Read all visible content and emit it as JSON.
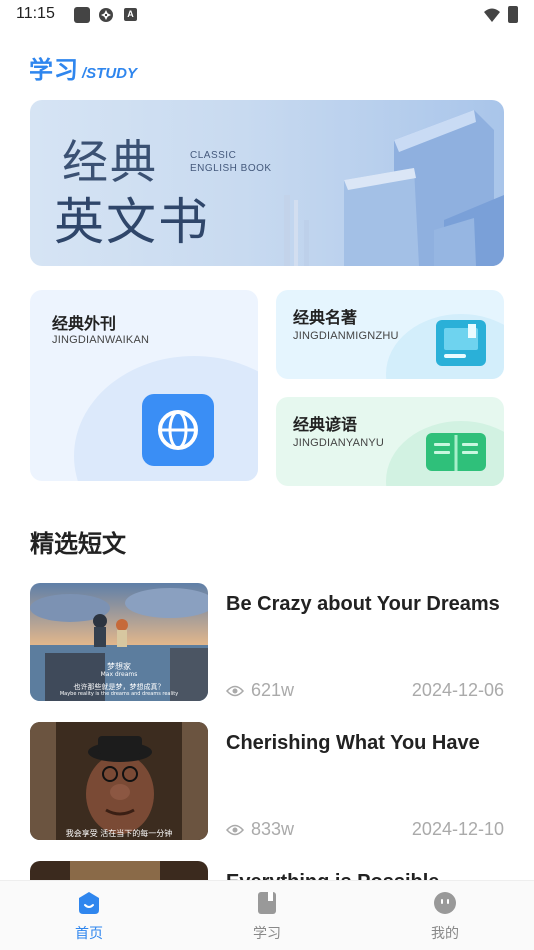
{
  "status_bar": {
    "time": "11:15"
  },
  "header": {
    "title_cn": "学习",
    "title_en": "/STUDY"
  },
  "banner": {
    "line1_cn": "经典",
    "line2_cn": "英文书",
    "line1_en": "CLASSIC",
    "line2_en": "ENGLISH BOOK"
  },
  "categories": [
    {
      "title": "经典外刊",
      "subtitle": "JINGDIANWAIKAN",
      "icon": "globe-icon"
    },
    {
      "title": "经典名著",
      "subtitle": "JINGDIANMIGNZHU",
      "icon": "book-icon"
    },
    {
      "title": "经典谚语",
      "subtitle": "JINGDIANYANYU",
      "icon": "open-book-icon"
    }
  ],
  "section": {
    "title": "精选短文"
  },
  "articles": [
    {
      "title": "Be Crazy about Your Dreams",
      "views": "621w",
      "date": "2024-12-06",
      "subtitle_lines": [
        "梦想家",
        "Max dreams",
        "也许那些就是梦，梦想成真？",
        "Maybe reality is the dreams and dreams reality"
      ]
    },
    {
      "title": "Cherishing What You Have",
      "views": "833w",
      "date": "2024-12-10",
      "subtitle_lines": [
        "我会享受 活在当下的每一分钟"
      ]
    },
    {
      "title": "Everything is Possible",
      "views": "",
      "date": "",
      "subtitle_lines": []
    }
  ],
  "tabbar": {
    "tabs": [
      {
        "label": "首页",
        "icon": "home-icon",
        "active": true
      },
      {
        "label": "学习",
        "icon": "notebook-icon",
        "active": false
      },
      {
        "label": "我的",
        "icon": "profile-face-icon",
        "active": false
      }
    ]
  },
  "colors": {
    "accent": "#2f86ee",
    "muted": "#aaaaaa"
  }
}
